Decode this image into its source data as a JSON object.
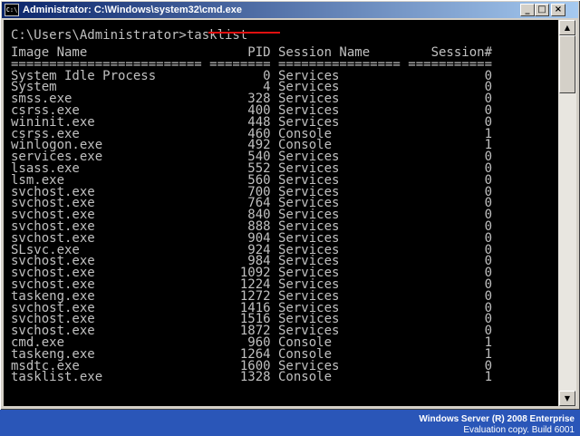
{
  "window": {
    "title": "Administrator: C:\\Windows\\system32\\cmd.exe",
    "min_glyph": "_",
    "max_glyph": "□",
    "close_glyph": "×"
  },
  "console": {
    "prompt": "C:\\Users\\Administrator>tasklist",
    "lines": [
      "Image Name                     PID Session Name        Session#",
      "========================= ======== ================ ===========",
      "System Idle Process              0 Services                   0",
      "System                           4 Services                   0",
      "smss.exe                       328 Services                   0",
      "csrss.exe                      400 Services                   0",
      "wininit.exe                    448 Services                   0",
      "csrss.exe                      460 Console                    1",
      "winlogon.exe                   492 Console                    1",
      "services.exe                   540 Services                   0",
      "lsass.exe                      552 Services                   0",
      "lsm.exe                        560 Services                   0",
      "svchost.exe                    700 Services                   0",
      "svchost.exe                    764 Services                   0",
      "svchost.exe                    840 Services                   0",
      "svchost.exe                    888 Services                   0",
      "svchost.exe                    904 Services                   0",
      "SLsvc.exe                      924 Services                   0",
      "svchost.exe                    984 Services                   0",
      "svchost.exe                   1092 Services                   0",
      "svchost.exe                   1224 Services                   0",
      "taskeng.exe                   1272 Services                   0",
      "svchost.exe                   1416 Services                   0",
      "svchost.exe                   1516 Services                   0",
      "svchost.exe                   1872 Services                   0",
      "cmd.exe                        960 Console                    1",
      "taskeng.exe                   1264 Console                    1",
      "msdtc.exe                     1600 Services                   0",
      "tasklist.exe                  1328 Console                    1"
    ]
  },
  "scrollbar": {
    "up_glyph": "▲",
    "down_glyph": "▼"
  },
  "desktop": {
    "edition": "Windows Server (R) 2008 Enterprise",
    "build": "Evaluation copy. Build 6001"
  },
  "colors": {
    "console_bg": "#000000",
    "console_fg": "#c0c0c0",
    "title_gradient_start": "#0a246a",
    "title_gradient_end": "#a6caf0",
    "desktop_bg": "#2a56b8",
    "underline": "#e01010"
  },
  "icons": {
    "app": "cmd-icon",
    "minimize": "minimize-icon",
    "maximize": "maximize-icon",
    "close": "close-icon"
  }
}
